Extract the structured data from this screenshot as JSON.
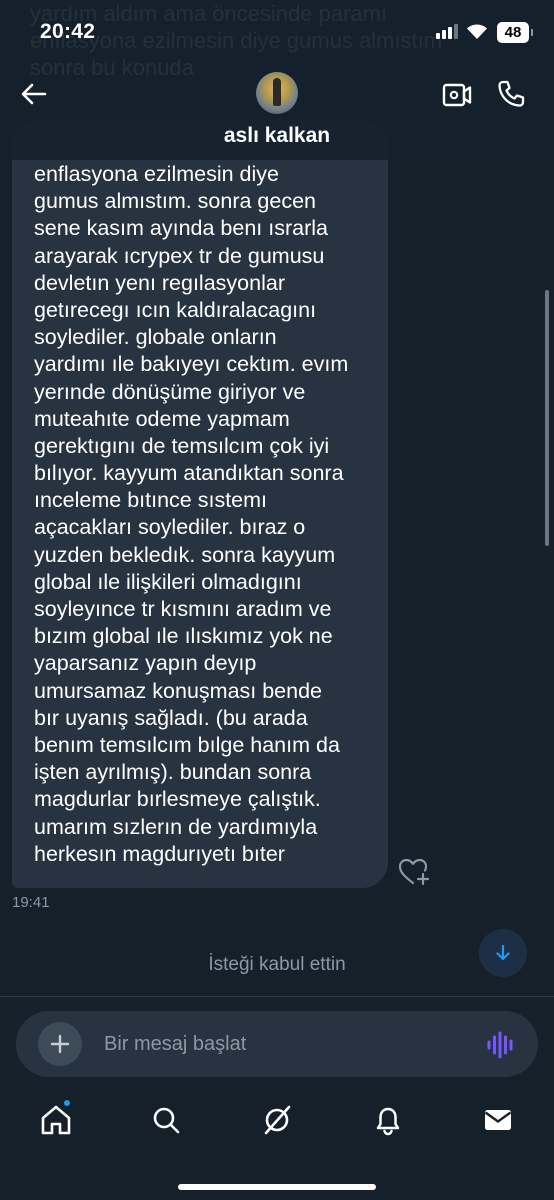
{
  "status_bar": {
    "time": "20:42",
    "battery": "48"
  },
  "header": {
    "contact_name": "aslı kalkan",
    "background_ghost_text": "yardım aldım ama öncesinde paramı enflasyona ezilmesin diye gumus almıstım sonra bu konuda"
  },
  "message": {
    "lines": [
      "enflasyona ezilmesin diye",
      "gumus almıstım. sonra gecen",
      "sene kasım ayında benı ısrarla",
      "arayarak ıcrypex tr de gumusu",
      "devletın yenı regılasyonlar",
      "getırecegı ıcın kaldıralacagını",
      "soylediler. globale onların",
      "yardımı ıle bakıyeyı cektım. evım",
      "yerınde dönüşüme giriyor ve",
      "muteahıte odeme yapmam",
      "gerektıgını de temsılcım çok iyi",
      "bılıyor. kayyum atandıktan sonra",
      "ınceleme bıtınce sıstemı",
      "açacakları soylediler. bıraz o",
      "yuzden bekledık. sonra kayyum",
      "global ıle ilişkileri olmadıgını",
      "soyleyınce tr kısmını aradım ve",
      "bızım global ıle ılıskımız yok ne",
      "yaparsanız yapın deyıp",
      "umursamaz konuşması bende",
      "bır uyanış sağladı. (bu arada",
      "benım temsılcım  bılge hanım da",
      "işten ayrılmış). bundan sonra",
      "magdurlar bırlesmeye çalıştık.",
      "umarım sızlerın de yardımıyla",
      "herkesın magdurıyetı bıter"
    ],
    "timestamp": "19:41"
  },
  "system_notice": "İsteği kabul ettin",
  "composer": {
    "placeholder": "Bir mesaj başlat"
  },
  "icons": {
    "back": "arrow-left-icon",
    "video": "video-camera-icon",
    "call": "phone-icon",
    "react": "heart-plus-icon",
    "scroll_down": "arrow-down-icon",
    "add": "plus-icon",
    "voice": "voice-wave-icon",
    "tabs": [
      "home-icon",
      "search-icon",
      "grok-icon",
      "bell-icon",
      "mail-icon"
    ]
  },
  "colors": {
    "background": "#15202b",
    "bubble": "#273340",
    "accent": "#1d9bf0",
    "voice_accent": "#7856ff",
    "muted_text": "#8b98a5"
  }
}
